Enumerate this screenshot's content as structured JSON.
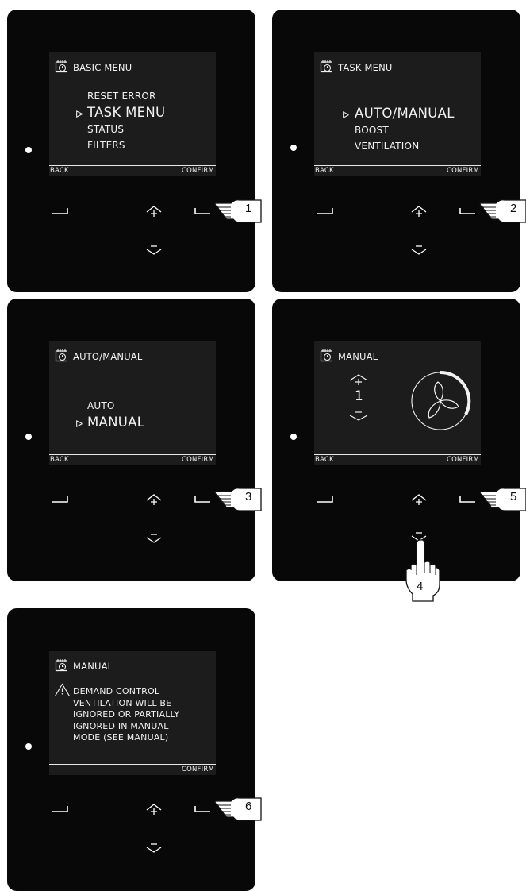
{
  "panels": [
    {
      "header": "BASIC MENU",
      "items": [
        {
          "label": "RESET ERROR",
          "selected": false
        },
        {
          "label": "TASK MENU",
          "selected": true
        },
        {
          "label": "STATUS",
          "selected": false
        },
        {
          "label": "FILTERS",
          "selected": false
        }
      ],
      "softkey_left": "BACK",
      "softkey_right": "CONFIRM",
      "step": "1"
    },
    {
      "header": "TASK MENU",
      "items": [
        {
          "label": "AUTO/MANUAL",
          "selected": true
        },
        {
          "label": "BOOST",
          "selected": false
        },
        {
          "label": "VENTILATION",
          "selected": false
        }
      ],
      "softkey_left": "BACK",
      "softkey_right": "CONFIRM",
      "step": "2"
    },
    {
      "header": "AUTO/MANUAL",
      "items": [
        {
          "label": "AUTO",
          "selected": false
        },
        {
          "label": "MANUAL",
          "selected": true
        }
      ],
      "softkey_left": "BACK",
      "softkey_right": "CONFIRM",
      "step": "3"
    },
    {
      "header": "MANUAL",
      "fan_level": "1",
      "softkey_left": "BACK",
      "softkey_right": "CONFIRM",
      "step_confirm": "5",
      "step_down": "4"
    },
    {
      "header": "MANUAL",
      "warning_lines": [
        "DEMAND CONTROL",
        "VENTILATION WILL BE",
        "IGNORED OR PARTIALLY",
        "IGNORED IN MANUAL",
        "MODE (SEE MANUAL)"
      ],
      "softkey_right": "CONFIRM",
      "step": "6"
    }
  ],
  "colors": {
    "panel": "#080808",
    "screen": "#1c1c1c",
    "screen_text": "#f2f2f2"
  }
}
